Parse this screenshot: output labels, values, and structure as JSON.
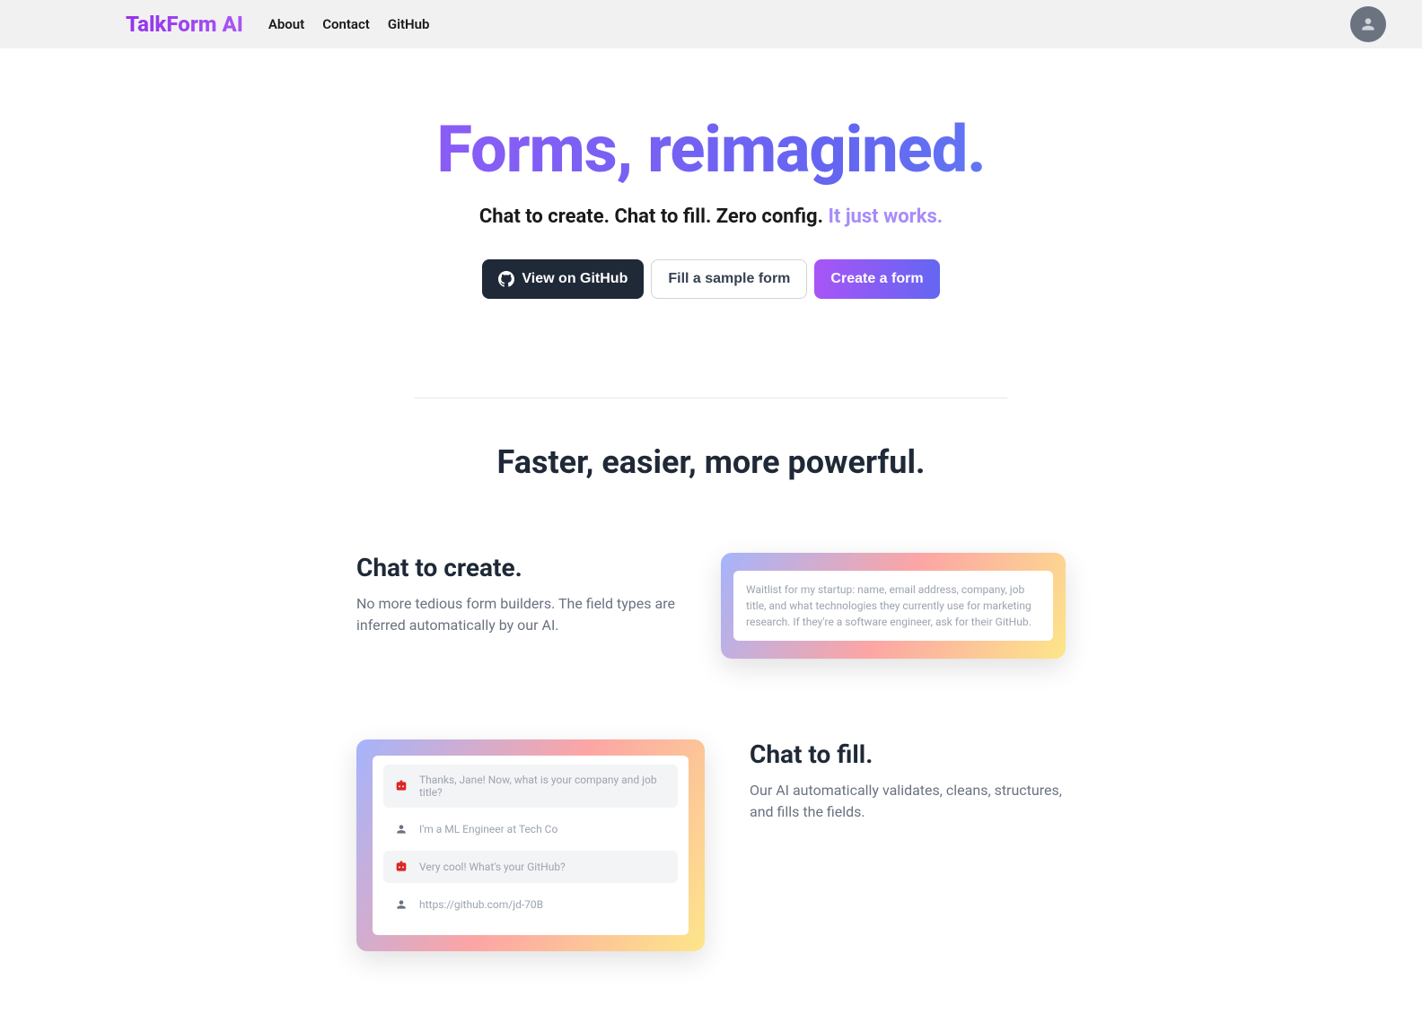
{
  "nav": {
    "logo": "TalkForm AI",
    "links": [
      "About",
      "Contact",
      "GitHub"
    ]
  },
  "hero": {
    "title": "Forms, reimagined.",
    "subtitle_plain": "Chat to create. Chat to fill. Zero config. ",
    "subtitle_emphasis": "It just works.",
    "cta_github": "View on GitHub",
    "cta_sample": "Fill a sample form",
    "cta_create": "Create a form"
  },
  "subheading": "Faster, easier, more powerful.",
  "feature1": {
    "title": "Chat to create.",
    "body": "No more tedious form builders. The field types are inferred automatically by our AI.",
    "demo_text": "Waitlist for my startup: name, email address, company, job title, and what technologies they currently use for marketing research. If they're a software engineer, ask for their GitHub."
  },
  "feature2": {
    "title": "Chat to fill.",
    "body": "Our AI automatically validates, cleans, structures, and fills the fields.",
    "chat": [
      {
        "role": "bot",
        "text": "Thanks, Jane! Now, what is your company and job title?"
      },
      {
        "role": "user",
        "text": "I'm a ML Engineer at Tech Co"
      },
      {
        "role": "bot",
        "text": "Very cool! What's your GitHub?"
      },
      {
        "role": "user",
        "text": "https://github.com/jd-70B"
      }
    ]
  }
}
